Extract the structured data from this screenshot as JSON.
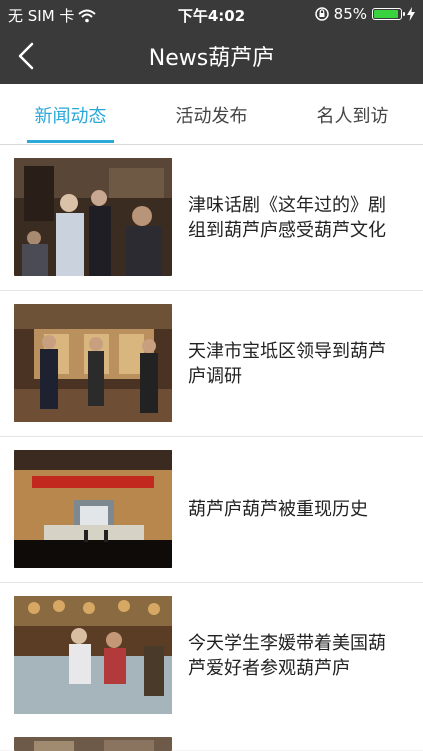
{
  "status_bar": {
    "carrier": "无 SIM 卡",
    "time": "下午4:02",
    "battery_percent": "85%",
    "battery_level": 0.85
  },
  "nav": {
    "title": "News葫芦庐",
    "back_icon": "chevron-left-icon"
  },
  "tabs": [
    {
      "label": "新闻动态",
      "active": true
    },
    {
      "label": "活动发布",
      "active": false
    },
    {
      "label": "名人到访",
      "active": false
    }
  ],
  "news": [
    {
      "title": "津味话剧《这年过的》剧组到葫芦庐感受葫芦文化"
    },
    {
      "title": "天津市宝坻区领导到葫芦庐调研"
    },
    {
      "title": "葫芦庐葫芦被重现历史"
    },
    {
      "title": "今天学生李媛带着美国葫芦爱好者参观葫芦庐"
    }
  ],
  "colors": {
    "bar_bg": "#3a3a3a",
    "accent": "#2aa8d8"
  }
}
